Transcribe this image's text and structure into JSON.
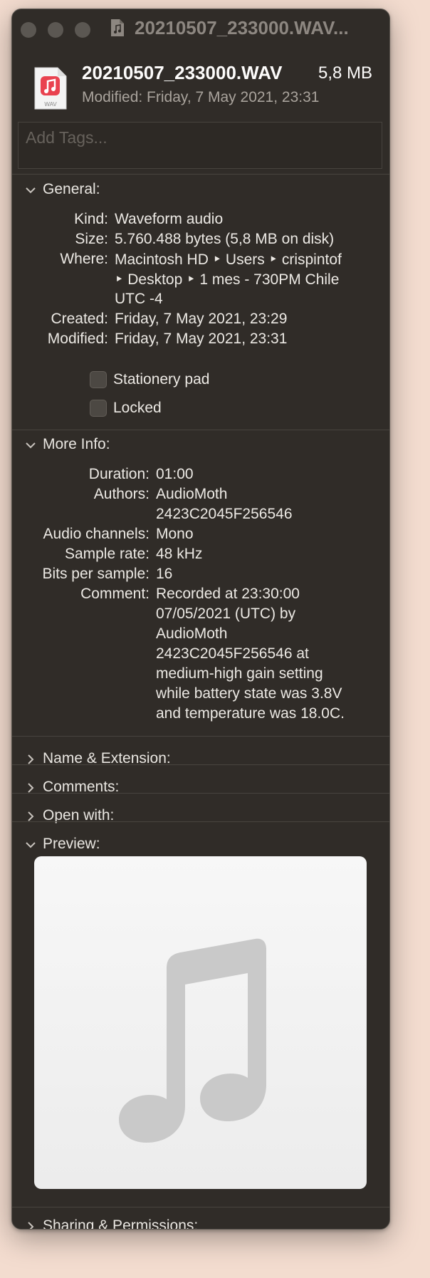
{
  "window": {
    "title": "20210507_233000.WAV..."
  },
  "header": {
    "file_name": "20210507_233000.WAV",
    "file_size": "5,8 MB",
    "modified": "Modified: Friday, 7 May 2021, 23:31",
    "icon_badge": "WAV",
    "tags_placeholder": "Add Tags..."
  },
  "general": {
    "title": "General:",
    "kind_label": "Kind:",
    "kind_value": "Waveform audio",
    "size_label": "Size:",
    "size_value": "5.760.488 bytes (5,8 MB on disk)",
    "where_label": "Where:",
    "where_line1": "Macintosh HD ‣ Users ‣ crispintof",
    "where_line2": "‣ Desktop ‣ 1 mes - 730PM Chile",
    "where_line3": "UTC -4",
    "created_label": "Created:",
    "created_value": "Friday, 7 May 2021, 23:29",
    "modified_label": "Modified:",
    "modified_value": "Friday, 7 May 2021, 23:31",
    "stationery_label": "Stationery pad",
    "stationery_checked": false,
    "locked_label": "Locked",
    "locked_checked": false
  },
  "more_info": {
    "title": "More Info:",
    "duration_label": "Duration:",
    "duration_value": "01:00",
    "authors_label": "Authors:",
    "authors_line1": "AudioMoth",
    "authors_line2": "2423C2045F256546",
    "channels_label": "Audio channels:",
    "channels_value": "Mono",
    "rate_label": "Sample rate:",
    "rate_value": "48 kHz",
    "bits_label": "Bits per sample:",
    "bits_value": "16",
    "comment_label": "Comment:",
    "comment_lines": [
      "Recorded at 23:30:00",
      "07/05/2021 (UTC) by",
      "AudioMoth",
      "2423C2045F256546 at",
      "medium-high gain setting",
      "while battery state was 3.8V",
      "and temperature was 18.0C."
    ]
  },
  "sections": {
    "name_ext": "Name & Extension:",
    "comments": "Comments:",
    "open_with": "Open with:",
    "preview": "Preview:",
    "sharing": "Sharing & Permissions:"
  },
  "colors": {
    "panel": "#302c28",
    "text": "#ece9e4",
    "accent_red": "#e9424f",
    "music_note": "#c9c9c9"
  }
}
